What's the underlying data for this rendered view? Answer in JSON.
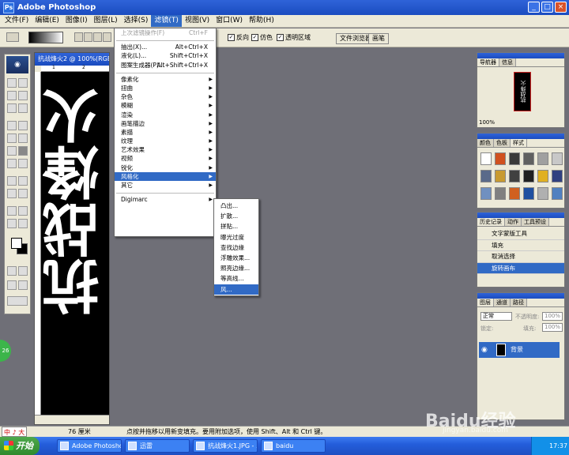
{
  "window": {
    "title": "Adobe Photoshop",
    "minimize": "_",
    "maximize": "□",
    "close": "×",
    "logo": "Ps"
  },
  "menubar": [
    {
      "label": "文件(F)"
    },
    {
      "label": "编辑(E)"
    },
    {
      "label": "图像(I)"
    },
    {
      "label": "图层(L)"
    },
    {
      "label": "选择(S)"
    },
    {
      "label": "滤镜(T)"
    },
    {
      "label": "视图(V)"
    },
    {
      "label": "窗口(W)"
    },
    {
      "label": "帮助(H)"
    }
  ],
  "options": {
    "reverse": "反向",
    "dither": "仿色",
    "transparency": "透明区域",
    "file_browser_tab": "文件浏览器",
    "brushes_tab": "画笔"
  },
  "document": {
    "title": "抗战烽火2 @ 100%(RGB)",
    "canvas_text": "抗战烽火",
    "ruler_h_1": "1",
    "ruler_h_2": "2"
  },
  "filter_menu": {
    "items": [
      {
        "label": "上次滤镜操作(F)",
        "shortcut": "Ctrl+F",
        "disabled": true
      },
      {
        "sep": true
      },
      {
        "label": "抽出(X)...",
        "shortcut": "Alt+Ctrl+X"
      },
      {
        "label": "液化(L)...",
        "shortcut": "Shift+Ctrl+X"
      },
      {
        "label": "图案生成器(P)...",
        "shortcut": "Alt+Shift+Ctrl+X"
      },
      {
        "sep": true
      },
      {
        "label": "像素化",
        "sub": true
      },
      {
        "label": "扭曲",
        "sub": true
      },
      {
        "label": "杂色",
        "sub": true
      },
      {
        "label": "模糊",
        "sub": true
      },
      {
        "label": "渲染",
        "sub": true
      },
      {
        "label": "画笔描边",
        "sub": true
      },
      {
        "label": "素描",
        "sub": true
      },
      {
        "label": "纹理",
        "sub": true
      },
      {
        "label": "艺术效果",
        "sub": true
      },
      {
        "label": "视频",
        "sub": true
      },
      {
        "label": "锐化",
        "sub": true
      },
      {
        "label": "风格化",
        "sub": true,
        "hl": true
      },
      {
        "label": "其它",
        "sub": true
      },
      {
        "sep": true
      },
      {
        "label": "Digimarc",
        "sub": true
      }
    ],
    "arrow": "▶"
  },
  "stylize_submenu": [
    {
      "label": "凸出..."
    },
    {
      "label": "扩散..."
    },
    {
      "label": "拼贴..."
    },
    {
      "label": "曝光过度"
    },
    {
      "label": "查找边缘"
    },
    {
      "label": "浮雕效果..."
    },
    {
      "label": "照亮边缘..."
    },
    {
      "label": "等高线..."
    },
    {
      "label": "风...",
      "hl": true
    }
  ],
  "navigator": {
    "tabs": [
      "导航器",
      "信息"
    ],
    "zoom": "100%",
    "thumb_text": "抗战烽火"
  },
  "swatches": {
    "tabs": [
      "颜色",
      "色板",
      "样式"
    ],
    "colors": [
      "#ffffff",
      "#d0501e",
      "#3a3a3a",
      "#606060",
      "#a0a0a0",
      "#c8c8c8",
      "#5a6a8a",
      "#c89a30",
      "#404040",
      "#202020",
      "#e0b020",
      "#304080",
      "#7090c0",
      "#808080",
      "#d06020",
      "#2050a0",
      "#b0b0b0",
      "#5080c0"
    ]
  },
  "history": {
    "tabs": [
      "历史记录",
      "动作",
      "工具预设"
    ],
    "items": [
      {
        "label": "文字蒙版工具"
      },
      {
        "label": "填充"
      },
      {
        "label": "取消选择"
      },
      {
        "label": "旋转画布",
        "hl": true
      }
    ]
  },
  "layers": {
    "tabs": [
      "图层",
      "通道",
      "路径"
    ],
    "blend": "正常",
    "opacity_label": "不透明度:",
    "opacity": "100%",
    "fill_label": "填充:",
    "fill": "100%",
    "layer_name": "背景",
    "lock_label": "锁定:"
  },
  "status": {
    "ime": "中 ♪ 大",
    "zoom": "76 厘米",
    "hint": "点按并拖移以用新变填充。要用附加选项，使用 Shift、Alt 和 Ctrl 键。"
  },
  "taskbar": {
    "start": "开始",
    "tasks": [
      {
        "label": "Adobe Photoshop"
      },
      {
        "label": "迅雷"
      },
      {
        "label": "抗战烽火1.JPG - ..."
      },
      {
        "label": "baidu"
      }
    ],
    "clock": "17:37"
  },
  "watermark": {
    "brand": "Baidu经验",
    "url": "jingyan.baidu.com"
  },
  "badge": "26"
}
